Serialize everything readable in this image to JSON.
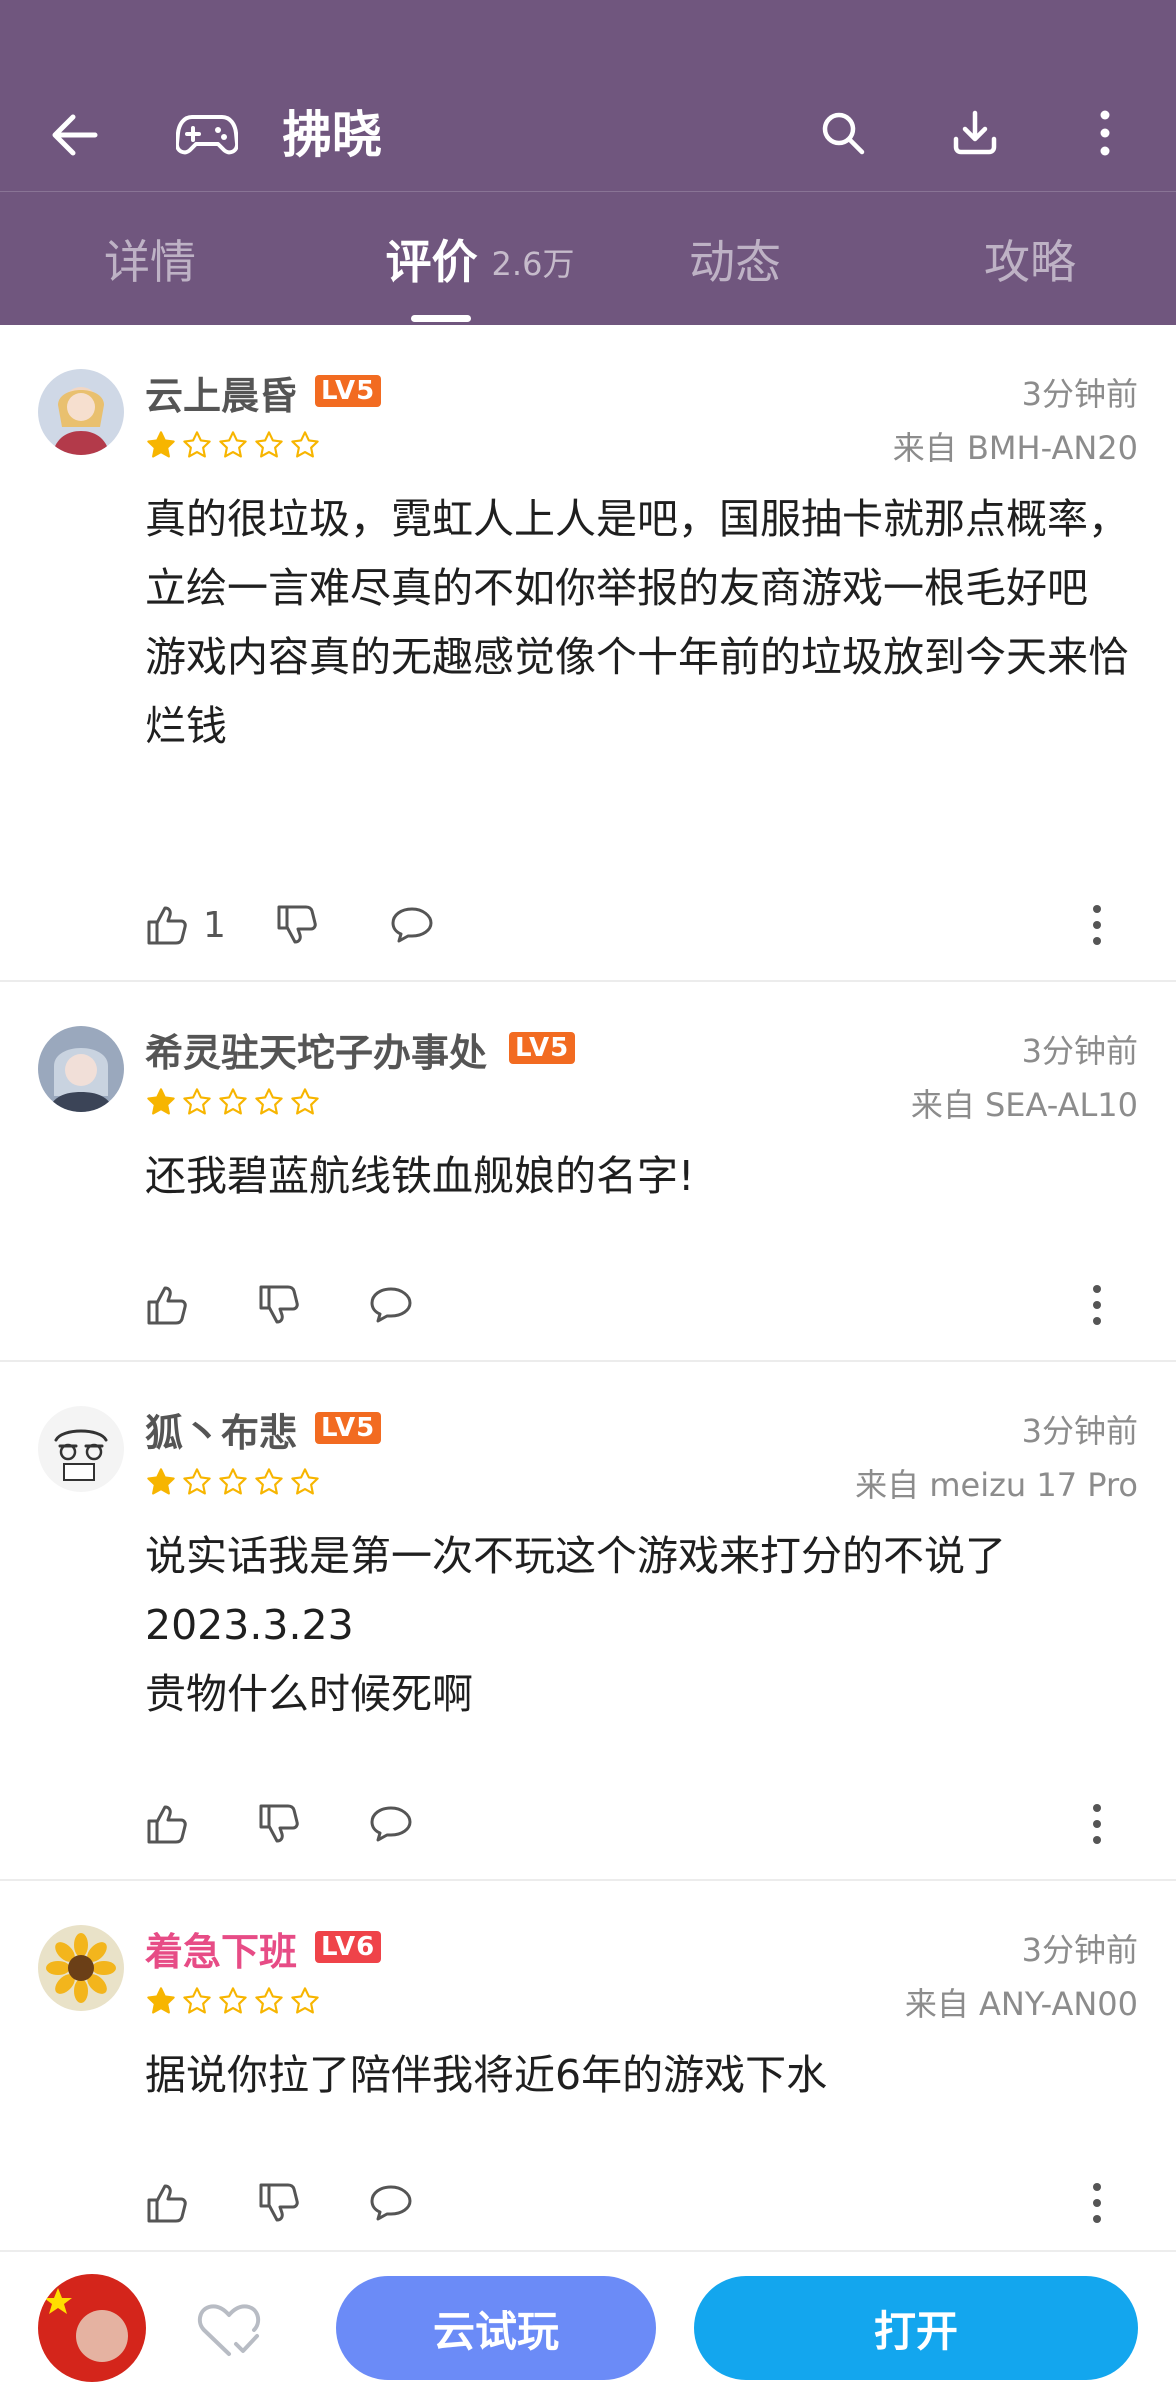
{
  "header": {
    "back_icon": "arrow-left-icon",
    "game_icon": "gamepad-icon",
    "title": "拂晓",
    "search_icon": "search-icon",
    "download_icon": "download-icon",
    "more_icon": "more-vertical-icon",
    "bg_color": "#70567e"
  },
  "tabs": [
    {
      "label": "详情",
      "active": false
    },
    {
      "label": "评价",
      "count": "2.6万",
      "active": true
    },
    {
      "label": "动态",
      "active": false
    },
    {
      "label": "攻略",
      "active": false
    }
  ],
  "reviews": [
    {
      "username": "云上晨昏",
      "level": "LV5",
      "time": "3分钟前",
      "device": "来自 BMH-AN20",
      "rating": 1,
      "rating_max": 5,
      "lines": [
        "真的很垃圾，霓虹人上人是吧，国服抽卡就那点概率，立绘一言难尽真的不如你举报的友商游戏一根毛好吧",
        "游戏内容真的无趣感觉像个十年前的垃圾放到今天来恰烂钱"
      ],
      "likes": "1"
    },
    {
      "username": "希灵驻天坨子办事处",
      "level": "LV5",
      "time": "3分钟前",
      "device": "来自 SEA-AL10",
      "rating": 1,
      "rating_max": 5,
      "lines": [
        "还我碧蓝航线铁血舰娘的名字!"
      ],
      "likes": ""
    },
    {
      "username": "狐丶布悲",
      "level": "LV5",
      "time": "3分钟前",
      "device": "来自 meizu 17 Pro",
      "rating": 1,
      "rating_max": 5,
      "lines": [
        "说实话我是第一次不玩这个游戏来打分的不说了",
        "2023.3.23",
        "贵物什么时候死啊"
      ],
      "likes": ""
    },
    {
      "username": "着急下班",
      "level": "LV6",
      "time": "3分钟前",
      "device": "来自 ANY-AN00",
      "rating": 1,
      "rating_max": 5,
      "lines": [
        "据说你拉了陪伴我将近6年的游戏下水"
      ],
      "likes": ""
    }
  ],
  "bottom_bar": {
    "favorite_icon": "heart-check-icon",
    "cloud_play_label": "云试玩",
    "open_label": "打开",
    "cloud_play_color": "#6b8bf7",
    "open_color": "#13a6ee"
  }
}
